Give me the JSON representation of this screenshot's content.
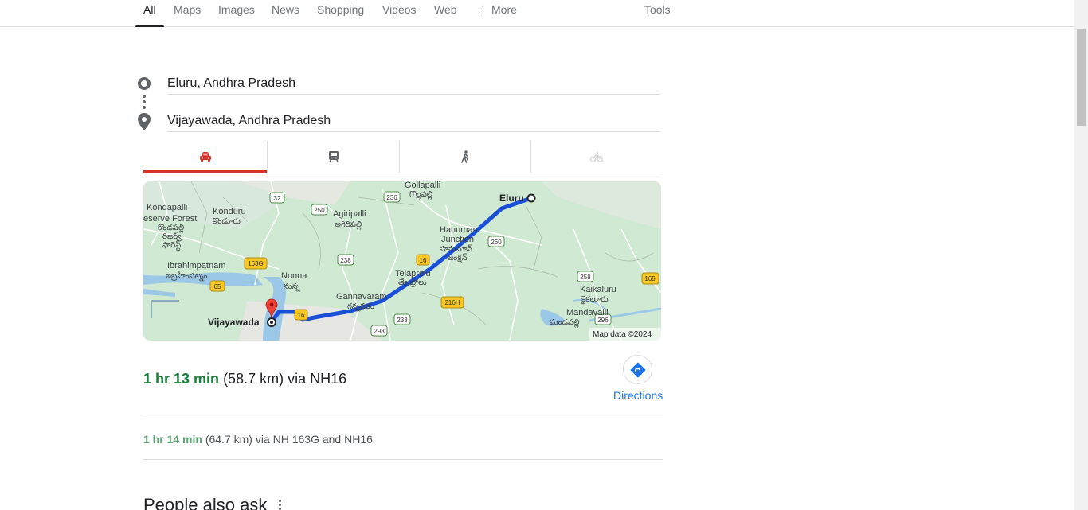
{
  "search_tabs": {
    "items": [
      "All",
      "Maps",
      "Images",
      "News",
      "Shopping",
      "Videos",
      "Web"
    ],
    "more_label": "More",
    "tools_label": "Tools",
    "active": "All"
  },
  "route": {
    "origin": "Eluru, Andhra Pradesh",
    "destination": "Vijayawada, Andhra Pradesh"
  },
  "modes": {
    "items": [
      "car-icon",
      "transit-icon",
      "walk-icon",
      "bicycle-icon"
    ],
    "active": "car-icon"
  },
  "map": {
    "labels": {
      "eluru": "Eluru",
      "vijayawada": "Vijayawada",
      "gollapalli": "Gollapalli",
      "gollapalli_te": "గొల్లపల్లి",
      "kondapalli": "Kondapalli",
      "reserve_forest": "eserve Forest",
      "konduru": "Konduru",
      "konduru_te": "కొండూరు",
      "kondapalli_te1": "కొండపల్లి",
      "kondapalli_te2": "రిజర్వ్",
      "kondapalli_te3": "ఫారెస్ట్",
      "agiripalli": "Agiripalli",
      "agiripalli_te": "అగిరిపల్లి",
      "hanuman_junction": "Hanuman",
      "hanuman_junction2": "Junction",
      "hanuman_te1": "హనుమాన్",
      "hanuman_te2": "జంక్షన్",
      "ibrahimpatnam": "Ibrahimpatnam",
      "ibrahimpatnam_te": "ఇబ్రహీంపట్నం",
      "nunna": "Nunna",
      "nunna_te": "నున్న",
      "telaprolu": "Telaprolu",
      "telaprolu_te": "తేలప్రోలు",
      "gannavaram": "Gannavaram",
      "gannavaram_te": "గన్నవరం",
      "kaikaluru": "Kaikaluru",
      "kaikaluru_te": "కైకలూరు",
      "mandavalli": "Mandavalli",
      "mandavalli_te": "మండవల్లి",
      "attribution": "Map data ©2024"
    },
    "shields": [
      "32",
      "250",
      "236",
      "238",
      "163G",
      "65",
      "16",
      "16",
      "260",
      "258",
      "165",
      "216H",
      "233",
      "298",
      "296"
    ]
  },
  "primary_route": {
    "time": "1 hr 13 min",
    "detail": "(58.7 km) via NH16"
  },
  "directions_label": "Directions",
  "alt_route": {
    "time": "1 hr 14 min",
    "detail": "(64.7 km) via NH 163G and NH16"
  },
  "people_also_ask": "People also ask",
  "colors": {
    "route_blue": "#1a4fd8",
    "time_green": "#188038",
    "active_mode_red": "#d93025",
    "link_blue": "#1a73e8"
  }
}
